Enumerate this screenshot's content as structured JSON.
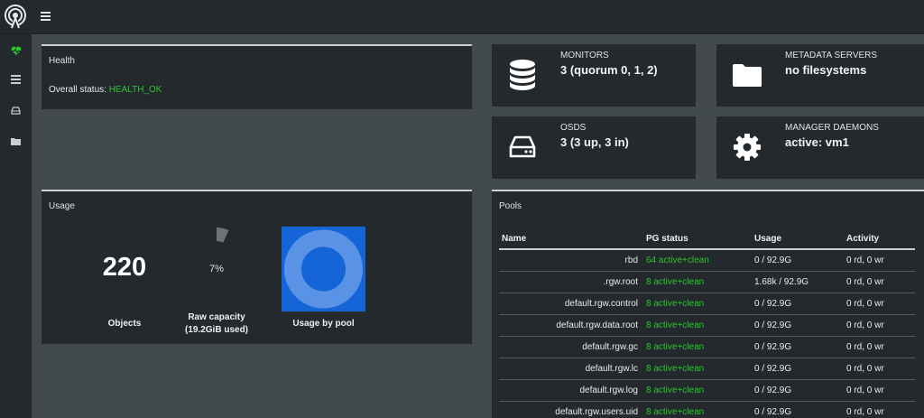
{
  "nav": {
    "logo_icon": "ceph-logo-icon",
    "menu_icon": "hamburger-menu-icon",
    "sidebar": [
      {
        "icon": "heartbeat-icon",
        "color": "#2bc62b"
      },
      {
        "icon": "list-icon",
        "color": "#c9cfd2"
      },
      {
        "icon": "hard-drive-icon",
        "color": "#c9cfd2"
      },
      {
        "icon": "folder-icon",
        "color": "#c9cfd2"
      }
    ]
  },
  "health": {
    "title": "Health",
    "status_label": "Overall status:",
    "status_value": "HEALTH_OK"
  },
  "cards": {
    "monitors": {
      "label": "MONITORS",
      "value": "3 (quorum 0, 1, 2)",
      "icon": "database-icon"
    },
    "metadata": {
      "label": "METADATA SERVERS",
      "value": "no filesystems",
      "icon": "folder-icon"
    },
    "osds": {
      "label": "OSDS",
      "value": "3 (3 up, 3 in)",
      "icon": "hard-drive-icon"
    },
    "managers": {
      "label": "MANAGER DAEMONS",
      "value": "active: vm1",
      "icon": "gear-icon"
    }
  },
  "usage": {
    "title": "Usage",
    "objects_count": "220",
    "objects_label": "Objects",
    "raw_percent_text": "7%",
    "raw_fraction": 0.07,
    "raw_label": "Raw capacity",
    "raw_sub": "(19.2GiB used)",
    "pool_label": "Usage by pool"
  },
  "pools": {
    "title": "Pools",
    "headers": {
      "name": "Name",
      "pg": "PG status",
      "usage": "Usage",
      "activity": "Activity"
    },
    "rows": [
      {
        "name": "rbd",
        "pg": "64 active+clean",
        "usage": "0 / 92.9G",
        "activity": "0 rd, 0 wr"
      },
      {
        "name": ".rgw.root",
        "pg": "8 active+clean",
        "usage": "1.68k / 92.9G",
        "activity": "0 rd, 0 wr"
      },
      {
        "name": "default.rgw.control",
        "pg": "8 active+clean",
        "usage": "0 / 92.9G",
        "activity": "0 rd, 0 wr"
      },
      {
        "name": "default.rgw.data.root",
        "pg": "8 active+clean",
        "usage": "0 / 92.9G",
        "activity": "0 rd, 0 wr"
      },
      {
        "name": "default.rgw.gc",
        "pg": "8 active+clean",
        "usage": "0 / 92.9G",
        "activity": "0 rd, 0 wr"
      },
      {
        "name": "default.rgw.lc",
        "pg": "8 active+clean",
        "usage": "0 / 92.9G",
        "activity": "0 rd, 0 wr"
      },
      {
        "name": "default.rgw.log",
        "pg": "8 active+clean",
        "usage": "0 / 92.9G",
        "activity": "0 rd, 0 wr"
      },
      {
        "name": "default.rgw.users.uid",
        "pg": "8 active+clean",
        "usage": "0 / 92.9G",
        "activity": "0 rd, 0 wr"
      }
    ]
  },
  "colors": {
    "ok": "#2bc62b",
    "pool_chart": "#1565d8"
  }
}
